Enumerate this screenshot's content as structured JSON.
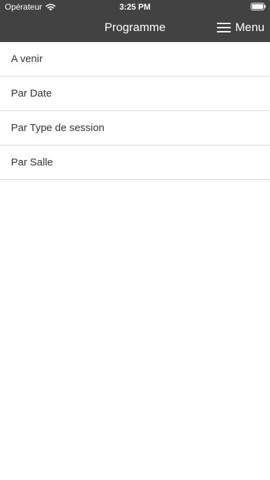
{
  "status_bar": {
    "carrier": "Opérateur",
    "time": "3:25 PM",
    "icons": [
      "wifi-icon",
      "battery-icon"
    ]
  },
  "nav": {
    "title": "Programme",
    "menu_label": "Menu",
    "menu_icon": "hamburger-icon"
  },
  "colors": {
    "header_bg": "#424242",
    "header_text": "#ffffff",
    "list_text": "#333333",
    "divider": "#d8d8d8"
  },
  "list": {
    "items": [
      {
        "label": "A venir"
      },
      {
        "label": "Par Date"
      },
      {
        "label": "Par Type de session"
      },
      {
        "label": "Par Salle"
      }
    ]
  }
}
